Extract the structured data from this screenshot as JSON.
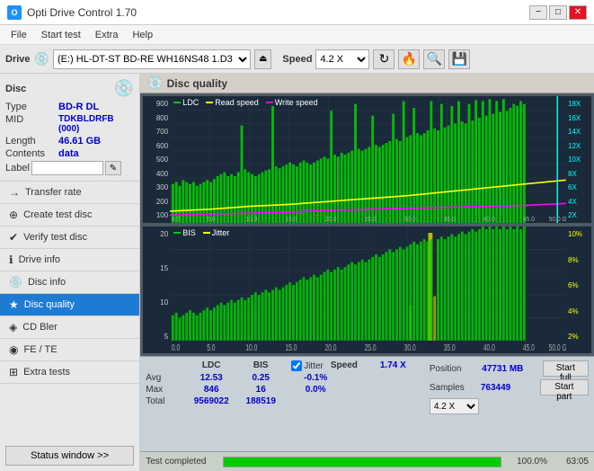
{
  "titlebar": {
    "title": "Opti Drive Control 1.70",
    "icon_label": "O",
    "btn_min": "−",
    "btn_max": "□",
    "btn_close": "✕"
  },
  "menubar": {
    "items": [
      "File",
      "Start test",
      "Extra",
      "Help"
    ]
  },
  "toolbar": {
    "drive_label": "Drive",
    "drive_value": "(E:) HL-DT-ST BD-RE WH16NS48 1.D3",
    "speed_label": "Speed",
    "speed_value": "4.2 X"
  },
  "disc": {
    "type_label": "Type",
    "type_value": "BD-R DL",
    "mid_label": "MID",
    "mid_value": "TDKBLDRFB (000)",
    "length_label": "Length",
    "length_value": "46.61 GB",
    "contents_label": "Contents",
    "contents_value": "data",
    "label_label": "Label"
  },
  "nav": {
    "items": [
      {
        "id": "transfer-rate",
        "label": "Transfer rate",
        "icon": "→"
      },
      {
        "id": "create-test-disc",
        "label": "Create test disc",
        "icon": "⊕"
      },
      {
        "id": "verify-test-disc",
        "label": "Verify test disc",
        "icon": "✔"
      },
      {
        "id": "drive-info",
        "label": "Drive info",
        "icon": "ℹ"
      },
      {
        "id": "disc-info",
        "label": "Disc info",
        "icon": "💿"
      },
      {
        "id": "disc-quality",
        "label": "Disc quality",
        "icon": "★",
        "active": true
      },
      {
        "id": "cd-bler",
        "label": "CD Bler",
        "icon": "◈"
      },
      {
        "id": "fe-te",
        "label": "FE / TE",
        "icon": "◉"
      },
      {
        "id": "extra-tests",
        "label": "Extra tests",
        "icon": "⊞"
      }
    ],
    "status_btn": "Status window >>"
  },
  "content": {
    "title": "Disc quality"
  },
  "chart1": {
    "legend": [
      {
        "label": "LDC",
        "color": "#00cc00"
      },
      {
        "label": "Read speed",
        "color": "#ffff00"
      },
      {
        "label": "Write speed",
        "color": "#ff00ff"
      }
    ],
    "y_max": 900,
    "y_right_max": 18,
    "y_labels_left": [
      "900",
      "800",
      "700",
      "600",
      "500",
      "400",
      "300",
      "200",
      "100"
    ],
    "y_labels_right": [
      "18X",
      "16X",
      "14X",
      "12X",
      "10X",
      "8X",
      "6X",
      "4X",
      "2X"
    ],
    "x_labels": [
      "0.0",
      "5.0",
      "10.0",
      "15.0",
      "20.0",
      "25.0",
      "30.0",
      "35.0",
      "40.0",
      "45.0",
      "50.0 GB"
    ]
  },
  "chart2": {
    "legend": [
      {
        "label": "BIS",
        "color": "#00cc00"
      },
      {
        "label": "Jitter",
        "color": "#ffff00"
      }
    ],
    "y_max": 20,
    "y_right_max": 10,
    "y_labels_left": [
      "20",
      "15",
      "10",
      "5"
    ],
    "y_labels_right": [
      "10%",
      "8%",
      "6%",
      "4%",
      "2%"
    ],
    "x_labels": [
      "0.0",
      "5.0",
      "10.0",
      "15.0",
      "20.0",
      "25.0",
      "30.0",
      "35.0",
      "40.0",
      "45.0",
      "50.0 GB"
    ]
  },
  "stats": {
    "col_headers": [
      "LDC",
      "BIS",
      "",
      "Jitter",
      "Speed"
    ],
    "avg_label": "Avg",
    "avg_ldc": "12.53",
    "avg_bis": "0.25",
    "avg_jitter": "-0.1%",
    "max_label": "Max",
    "max_ldc": "846",
    "max_bis": "16",
    "max_jitter": "0.0%",
    "total_label": "Total",
    "total_ldc": "9569022",
    "total_bis": "188519",
    "speed_label": "Speed",
    "speed_value": "1.74 X",
    "speed_select": "4.2 X",
    "position_label": "Position",
    "position_value": "47731 MB",
    "samples_label": "Samples",
    "samples_value": "763449",
    "btn_start_full": "Start full",
    "btn_start_part": "Start part",
    "jitter_label": "Jitter",
    "jitter_checked": true
  },
  "progressbar": {
    "label": "Test completed",
    "percent": 100.0,
    "percent_display": "100.0%",
    "time": "63:05"
  }
}
